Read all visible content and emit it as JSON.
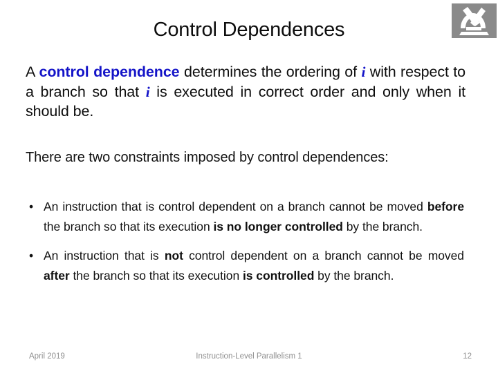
{
  "slide": {
    "title": "Control Dependences",
    "background_color": "#ffffff",
    "accent_color": "#1414c8",
    "logo": {
      "icon_name": "microscope-logo-icon",
      "background_color": "#8a8a8a",
      "foreground_color": "#ffffff"
    }
  },
  "quote": {
    "part1": "A ",
    "accent1": "control dependence",
    "part2": " determines the ordering of ",
    "var1": "i",
    "part3": " with respect to a branch so that ",
    "var2": "i",
    "part4": " is executed in correct order and only when it should be."
  },
  "lead": {
    "text": "There are two constraints imposed by control dependences:"
  },
  "bullets": {
    "marker": "•",
    "items": [
      {
        "seg1": "An instruction that is control dependent on a branch cannot be moved ",
        "bold1": "before",
        "seg2": " the branch so that its execution ",
        "bold2": "is no longer controlled",
        "seg3": " by the branch."
      },
      {
        "seg1": "An instruction that is ",
        "bold1": "not",
        "seg2": " control dependent on a branch cannot be moved ",
        "bold2": "after",
        "seg3": " the branch so that its execution ",
        "bold3": "is controlled",
        "seg4": " by the branch."
      }
    ]
  },
  "footer": {
    "date": "April 2019",
    "subject": "Instruction-Level Parallelism 1",
    "page_number": "12"
  }
}
